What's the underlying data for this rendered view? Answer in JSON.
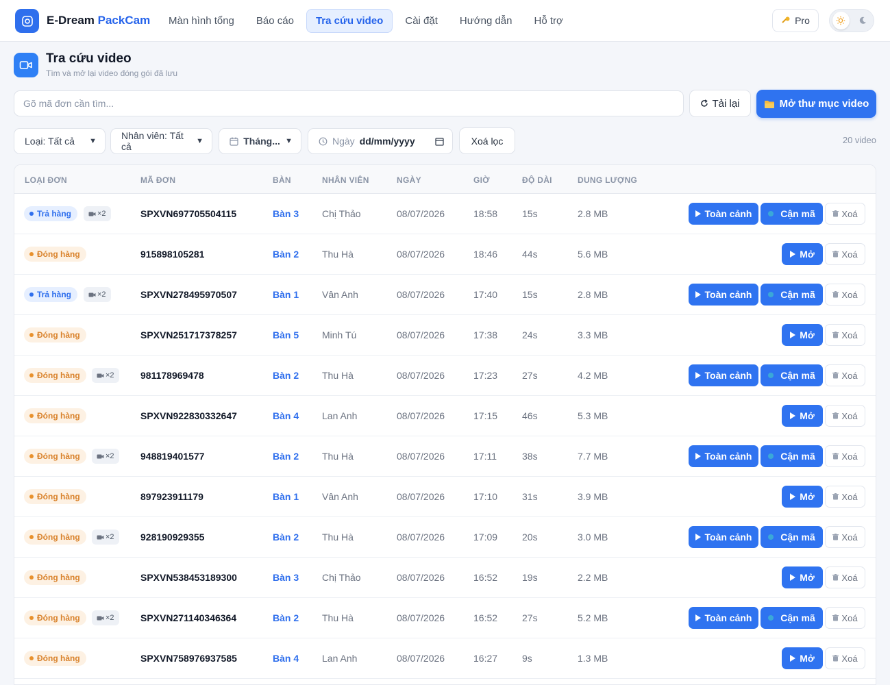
{
  "app": {
    "brand_main": "E-Dream ",
    "brand_accent": "PackCam"
  },
  "nav": {
    "items": [
      {
        "label": "Màn hình tổng",
        "active": false
      },
      {
        "label": "Báo cáo",
        "active": false
      },
      {
        "label": "Tra cứu video",
        "active": true
      },
      {
        "label": "Cài đặt",
        "active": false
      },
      {
        "label": "Hướng dẫn",
        "active": false
      },
      {
        "label": "Hỗ trợ",
        "active": false
      }
    ],
    "pro_label": "Pro"
  },
  "page": {
    "title": "Tra cứu video",
    "subtitle": "Tìm và mở lại video đóng gói đã lưu"
  },
  "search": {
    "placeholder": "Gõ mã đơn cần tìm...",
    "value": ""
  },
  "actions": {
    "reload_label": "Tải lại",
    "open_folder_label": "Mở thư mục video"
  },
  "filters": {
    "type_label": "Loại: Tất cả",
    "staff_label": "Nhân viên: Tất cả",
    "month_label": "Tháng...",
    "date_label": "Ngày",
    "date_value": "dd/mm/yyyy",
    "clear_label": "Xoá lọc",
    "count_label": "20 video"
  },
  "table": {
    "columns": [
      "LOẠI ĐƠN",
      "MÃ ĐƠN",
      "BÀN",
      "NHÂN VIÊN",
      "NGÀY",
      "GIỜ",
      "ĐỘ DÀI",
      "DUNG LƯỢNG"
    ],
    "action_labels": {
      "overview": "Toàn cảnh",
      "closeup": "Cận mã",
      "open": "Mở",
      "delete": "Xoá"
    },
    "rows": [
      {
        "type": "Trả hàng",
        "kind": "return",
        "cams": "×2",
        "code": "SPXVN697705504115",
        "desk": "Bàn 3",
        "staff": "Chị Thảo",
        "date": "08/07/2026",
        "time": "18:58",
        "duration": "15s",
        "size": "2.8 MB"
      },
      {
        "type": "Đóng hàng",
        "kind": "pack",
        "cams": "",
        "code": "915898105281",
        "desk": "Bàn 2",
        "staff": "Thu Hà",
        "date": "08/07/2026",
        "time": "18:46",
        "duration": "44s",
        "size": "5.6 MB"
      },
      {
        "type": "Trả hàng",
        "kind": "return",
        "cams": "×2",
        "code": "SPXVN278495970507",
        "desk": "Bàn 1",
        "staff": "Vân Anh",
        "date": "08/07/2026",
        "time": "17:40",
        "duration": "15s",
        "size": "2.8 MB"
      },
      {
        "type": "Đóng hàng",
        "kind": "pack",
        "cams": "",
        "code": "SPXVN251717378257",
        "desk": "Bàn 5",
        "staff": "Minh Tú",
        "date": "08/07/2026",
        "time": "17:38",
        "duration": "24s",
        "size": "3.3 MB"
      },
      {
        "type": "Đóng hàng",
        "kind": "pack",
        "cams": "×2",
        "code": "981178969478",
        "desk": "Bàn 2",
        "staff": "Thu Hà",
        "date": "08/07/2026",
        "time": "17:23",
        "duration": "27s",
        "size": "4.2 MB"
      },
      {
        "type": "Đóng hàng",
        "kind": "pack",
        "cams": "",
        "code": "SPXVN922830332647",
        "desk": "Bàn 4",
        "staff": "Lan Anh",
        "date": "08/07/2026",
        "time": "17:15",
        "duration": "46s",
        "size": "5.3 MB"
      },
      {
        "type": "Đóng hàng",
        "kind": "pack",
        "cams": "×2",
        "code": "948819401577",
        "desk": "Bàn 2",
        "staff": "Thu Hà",
        "date": "08/07/2026",
        "time": "17:11",
        "duration": "38s",
        "size": "7.7 MB"
      },
      {
        "type": "Đóng hàng",
        "kind": "pack",
        "cams": "",
        "code": "897923911179",
        "desk": "Bàn 1",
        "staff": "Vân Anh",
        "date": "08/07/2026",
        "time": "17:10",
        "duration": "31s",
        "size": "3.9 MB"
      },
      {
        "type": "Đóng hàng",
        "kind": "pack",
        "cams": "×2",
        "code": "928190929355",
        "desk": "Bàn 2",
        "staff": "Thu Hà",
        "date": "08/07/2026",
        "time": "17:09",
        "duration": "20s",
        "size": "3.0 MB"
      },
      {
        "type": "Đóng hàng",
        "kind": "pack",
        "cams": "",
        "code": "SPXVN538453189300",
        "desk": "Bàn 3",
        "staff": "Chị Thảo",
        "date": "08/07/2026",
        "time": "16:52",
        "duration": "19s",
        "size": "2.2 MB"
      },
      {
        "type": "Đóng hàng",
        "kind": "pack",
        "cams": "×2",
        "code": "SPXVN271140346364",
        "desk": "Bàn 2",
        "staff": "Thu Hà",
        "date": "08/07/2026",
        "time": "16:52",
        "duration": "27s",
        "size": "5.2 MB"
      },
      {
        "type": "Đóng hàng",
        "kind": "pack",
        "cams": "",
        "code": "SPXVN758976937585",
        "desk": "Bàn 4",
        "staff": "Lan Anh",
        "date": "08/07/2026",
        "time": "16:27",
        "duration": "9s",
        "size": "1.3 MB"
      }
    ]
  },
  "colors": {
    "primary": "#2f73f0",
    "return_badge": "#2f6fed",
    "pack_badge": "#d9822b"
  }
}
